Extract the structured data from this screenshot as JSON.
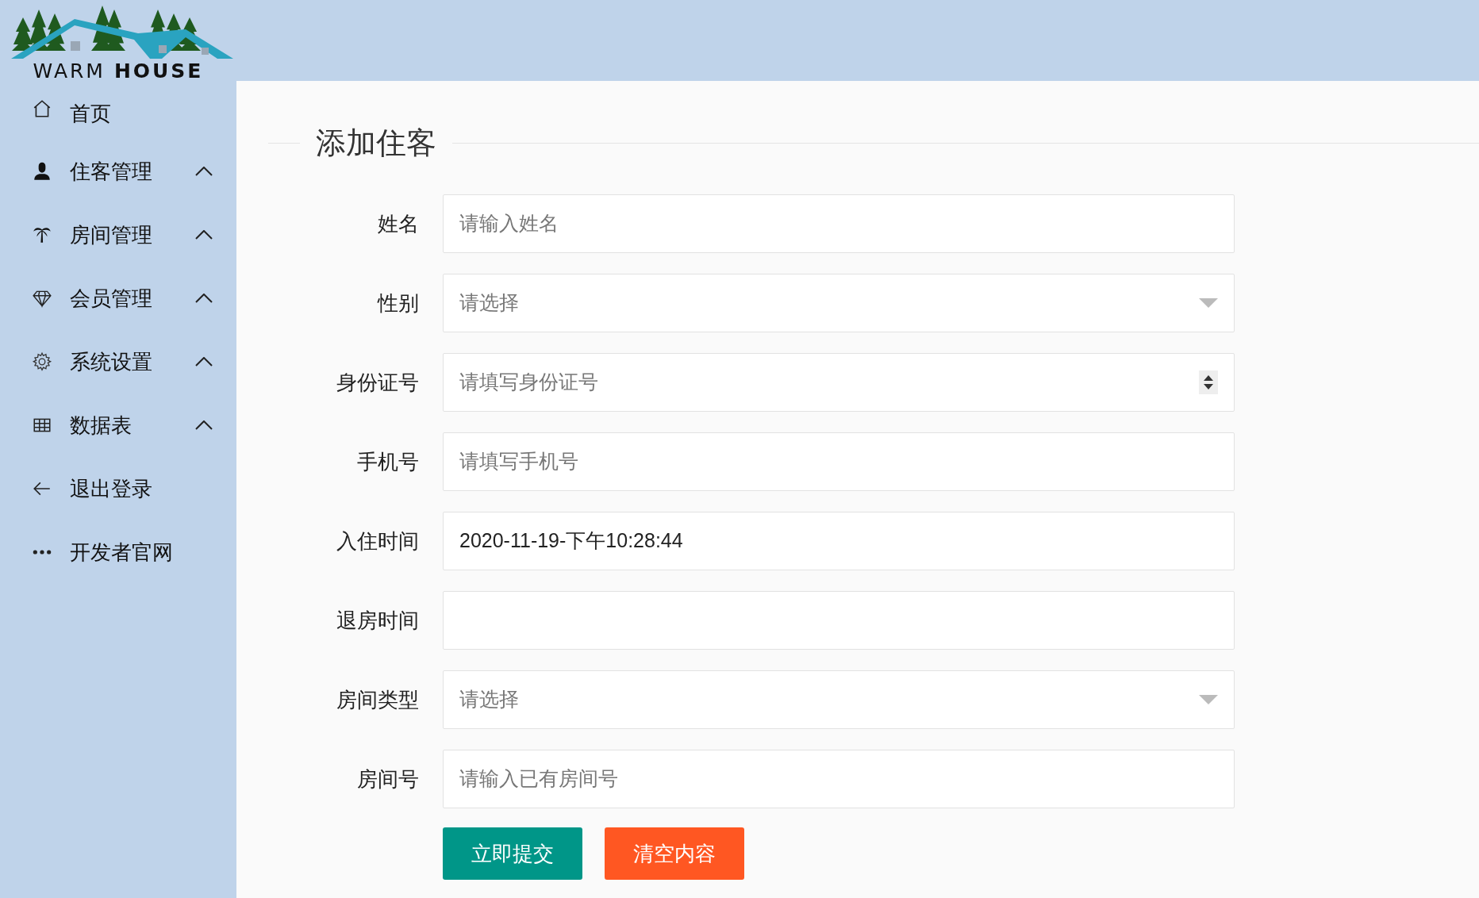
{
  "logo": {
    "text_light": "WARM ",
    "text_bold": "HOUSE"
  },
  "sidebar": {
    "items": [
      {
        "label": "首页",
        "kind": "link"
      },
      {
        "label": "住客管理",
        "kind": "group",
        "expanded": false
      },
      {
        "label": "房间管理",
        "kind": "group",
        "expanded": false
      },
      {
        "label": "会员管理",
        "kind": "group",
        "expanded": false
      },
      {
        "label": "系统设置",
        "kind": "group",
        "expanded": false
      },
      {
        "label": "数据表",
        "kind": "group",
        "expanded": false
      },
      {
        "label": "退出登录",
        "kind": "link"
      },
      {
        "label": "开发者官网",
        "kind": "link"
      }
    ]
  },
  "form": {
    "title": "添加住客",
    "fields": [
      {
        "label": "姓名",
        "kind": "text",
        "placeholder": "请输入姓名"
      },
      {
        "label": "性别",
        "kind": "select",
        "placeholder": "请选择"
      },
      {
        "label": "身份证号",
        "kind": "number",
        "placeholder": "请填写身份证号"
      },
      {
        "label": "手机号",
        "kind": "text",
        "placeholder": "请填写手机号"
      },
      {
        "label": "入住时间",
        "kind": "text",
        "value": "2020-11-19-下午10:28:44"
      },
      {
        "label": "退房时间",
        "kind": "text"
      },
      {
        "label": "房间类型",
        "kind": "select",
        "placeholder": "请选择"
      },
      {
        "label": "房间号",
        "kind": "text",
        "placeholder": "请输入已有房间号"
      }
    ],
    "buttons": [
      {
        "label": "立即提交",
        "kind": "submit"
      },
      {
        "label": "清空内容",
        "kind": "reset"
      }
    ]
  }
}
